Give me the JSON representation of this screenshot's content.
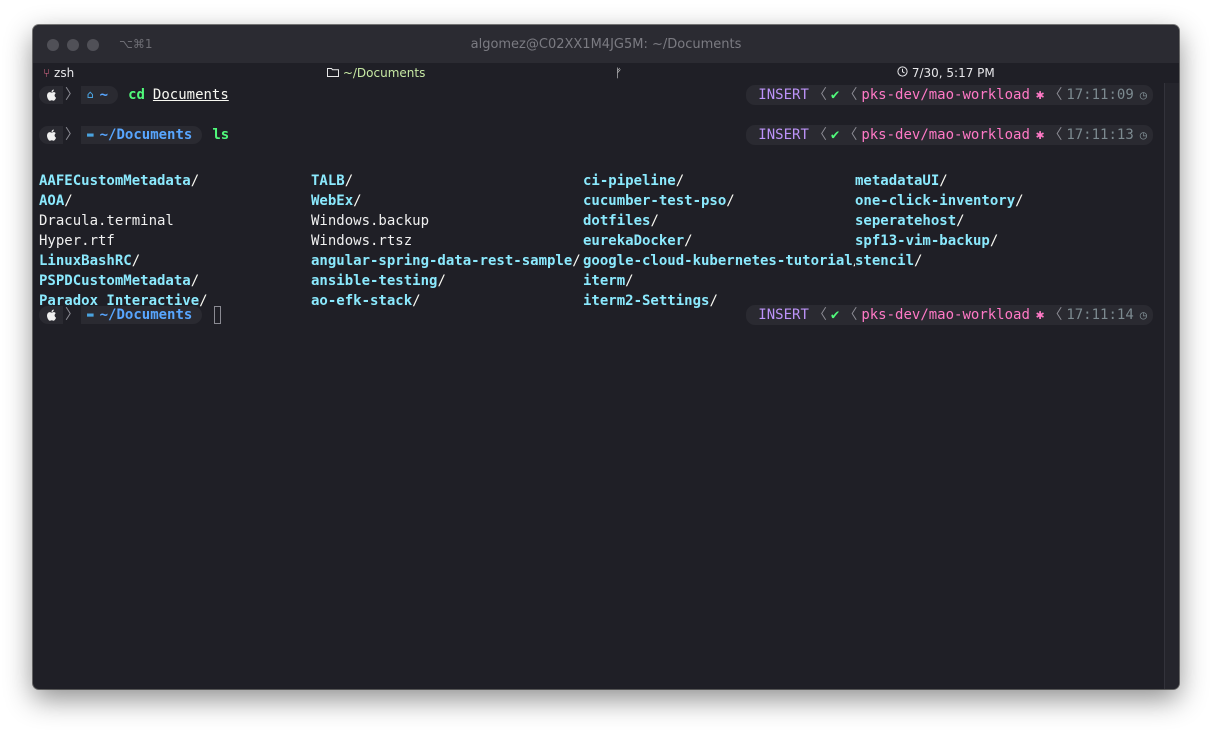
{
  "window": {
    "title": "algomez@C02XX1M4JG5M: ~/Documents",
    "shortcut": "⌥⌘1"
  },
  "status_bar": {
    "shell": "zsh",
    "directory": "~/Documents",
    "branch_icon": "ᚠ",
    "datetime": "7/30, 5:17 PM"
  },
  "prompts": [
    {
      "dir": "~",
      "command": "cd",
      "argument": "Documents",
      "mode": "INSERT",
      "branch": "pks-dev/mao-workload",
      "time": "17:11:09"
    },
    {
      "dir": "~/Documents",
      "command": "ls",
      "mode": "INSERT",
      "branch": "pks-dev/mao-workload",
      "time": "17:11:13"
    },
    {
      "dir": "~/Documents",
      "mode": "INSERT",
      "branch": "pks-dev/mao-workload",
      "time": "17:11:14"
    }
  ],
  "listing": [
    {
      "name": "AAFECustomMetadata",
      "dir": true
    },
    {
      "name": "TALB",
      "dir": true
    },
    {
      "name": "ci-pipeline",
      "dir": true
    },
    {
      "name": "metadataUI",
      "dir": true
    },
    {
      "name": "AOA",
      "dir": true
    },
    {
      "name": "WebEx",
      "dir": true
    },
    {
      "name": "cucumber-test-pso",
      "dir": true
    },
    {
      "name": "one-click-inventory",
      "dir": true
    },
    {
      "name": "Dracula.terminal",
      "dir": false
    },
    {
      "name": "Windows.backup",
      "dir": false
    },
    {
      "name": "dotfiles",
      "dir": true
    },
    {
      "name": "seperatehost",
      "dir": true
    },
    {
      "name": "Hyper.rtf",
      "dir": false
    },
    {
      "name": "Windows.rtsz",
      "dir": false
    },
    {
      "name": "eurekaDocker",
      "dir": true
    },
    {
      "name": "spf13-vim-backup",
      "dir": true
    },
    {
      "name": "LinuxBashRC",
      "dir": true
    },
    {
      "name": "angular-spring-data-rest-sample",
      "dir": true
    },
    {
      "name": "google-cloud-kubernetes-tutorial",
      "dir": true
    },
    {
      "name": "stencil",
      "dir": true
    },
    {
      "name": "PSPDCustomMetadata",
      "dir": true
    },
    {
      "name": "ansible-testing",
      "dir": true
    },
    {
      "name": "iterm",
      "dir": true
    },
    {
      "name": "",
      "dir": false
    },
    {
      "name": "Paradox Interactive",
      "dir": true
    },
    {
      "name": "ao-efk-stack",
      "dir": true
    },
    {
      "name": "iterm2-Settings",
      "dir": true
    },
    {
      "name": "",
      "dir": false
    }
  ],
  "colors": {
    "background": "#1f1f26",
    "directory": "#8be9fd",
    "command": "#50fa7b",
    "mode": "#bd93f9",
    "branch": "#ff79c6"
  }
}
